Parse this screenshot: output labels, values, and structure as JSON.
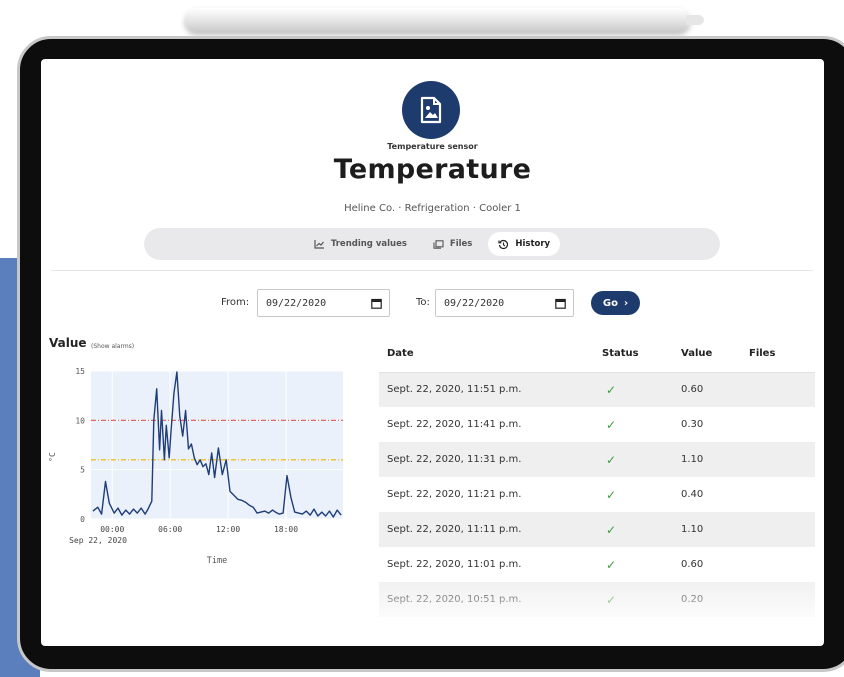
{
  "header": {
    "subtitle": "Temperature sensor",
    "title": "Temperature",
    "breadcrumb": "Heline Co. · Refrigeration · Cooler 1"
  },
  "tabs": [
    {
      "label": "Trending values",
      "icon": "chart-line-icon"
    },
    {
      "label": "Files",
      "icon": "files-icon"
    },
    {
      "label": "History",
      "icon": "history-icon",
      "active": true
    }
  ],
  "filter": {
    "from_label": "From:",
    "from_value": "09/22/2020",
    "to_label": "To:",
    "to_value": "09/22/2020",
    "go_label": "Go"
  },
  "chart": {
    "title": "Value",
    "show_alarms": "(Show alarms)",
    "y_label": "°C",
    "x_label": "Time",
    "date_label": "Sep 22, 2020"
  },
  "chart_data": {
    "type": "line",
    "ylabel": "°C",
    "xlabel": "Time",
    "ylim": [
      0,
      15
    ],
    "y_ticks": [
      "0",
      "5",
      "10",
      "15"
    ],
    "x_ticks": [
      "00:00",
      "06:00",
      "12:00",
      "18:00"
    ],
    "x_tick_hours": [
      0,
      6,
      12,
      18
    ],
    "xlim_hours": [
      -2.2,
      23.9
    ],
    "threshold_lines": [
      {
        "value": 10,
        "color": "#e05252"
      },
      {
        "value": 6,
        "color": "#f0b400"
      }
    ],
    "series": [
      {
        "color": "#1f3d7a",
        "x": [
          -2.0,
          -1.5,
          -1.1,
          -0.7,
          -0.3,
          0.2,
          0.6,
          1.0,
          1.4,
          1.8,
          2.2,
          2.6,
          3.0,
          3.4,
          3.7,
          4.1,
          4.3,
          4.6,
          4.9,
          5.1,
          5.4,
          5.6,
          5.9,
          6.1,
          6.4,
          6.7,
          7.0,
          7.3,
          7.6,
          7.9,
          8.2,
          8.5,
          8.8,
          9.1,
          9.4,
          9.7,
          10.0,
          10.3,
          10.6,
          11.0,
          11.4,
          11.8,
          12.2,
          12.6,
          13.0,
          13.4,
          13.8,
          14.2,
          14.6,
          15.0,
          15.4,
          15.8,
          16.2,
          16.6,
          16.9,
          17.3,
          17.7,
          18.1,
          18.5,
          18.9,
          19.3,
          19.7,
          20.1,
          20.5,
          20.9,
          21.3,
          21.7,
          22.1,
          22.5,
          22.9,
          23.3,
          23.7
        ],
        "y": [
          0.8,
          1.2,
          0.5,
          3.8,
          1.6,
          0.6,
          1.1,
          0.4,
          0.9,
          0.5,
          1.0,
          0.6,
          1.1,
          0.5,
          1.0,
          1.8,
          10.0,
          13.2,
          7.0,
          11.0,
          6.0,
          9.5,
          6.2,
          9.0,
          12.8,
          14.9,
          10.4,
          8.4,
          11.0,
          7.1,
          7.6,
          6.2,
          5.5,
          6.0,
          5.3,
          5.6,
          4.5,
          6.7,
          4.2,
          7.2,
          4.5,
          6.0,
          2.8,
          2.4,
          2.0,
          1.9,
          1.7,
          1.4,
          1.2,
          0.6,
          0.7,
          0.8,
          0.6,
          0.9,
          0.7,
          0.5,
          0.6,
          4.4,
          2.2,
          0.7,
          0.6,
          0.5,
          0.8,
          0.4,
          1.0,
          0.3,
          0.7,
          0.3,
          0.8,
          0.2,
          0.9,
          0.4
        ]
      }
    ]
  },
  "table": {
    "headers": [
      "Date",
      "Status",
      "Value",
      "Files"
    ],
    "rows": [
      {
        "date": "Sept. 22, 2020, 11:51 p.m.",
        "status": "✓",
        "value": "0.60",
        "files": ""
      },
      {
        "date": "Sept. 22, 2020, 11:41 p.m.",
        "status": "✓",
        "value": "0.30",
        "files": ""
      },
      {
        "date": "Sept. 22, 2020, 11:31 p.m.",
        "status": "✓",
        "value": "1.10",
        "files": ""
      },
      {
        "date": "Sept. 22, 2020, 11:21 p.m.",
        "status": "✓",
        "value": "0.40",
        "files": ""
      },
      {
        "date": "Sept. 22, 2020, 11:11 p.m.",
        "status": "✓",
        "value": "1.10",
        "files": ""
      },
      {
        "date": "Sept. 22, 2020, 11:01 p.m.",
        "status": "✓",
        "value": "0.60",
        "files": ""
      },
      {
        "date": "Sept. 22, 2020, 10:51 p.m.",
        "status": "✓",
        "value": "0.20",
        "files": ""
      }
    ]
  },
  "colors": {
    "brand": "#1e3b6e",
    "ok": "#3a9f3a",
    "accent_panel": "#5b7fbc"
  }
}
